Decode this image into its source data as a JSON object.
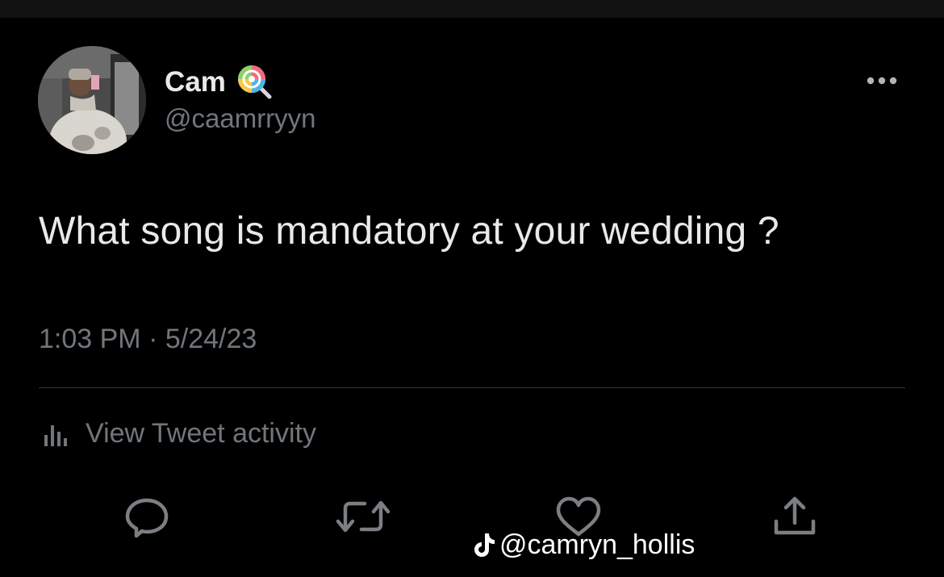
{
  "user": {
    "display_name": "Cam",
    "handle": "@caamrryyn",
    "name_emoji": "lollipop-icon"
  },
  "tweet": {
    "text": "What song is mandatory at your wedding ?",
    "time": "1:03 PM",
    "separator": "·",
    "date": "5/24/23"
  },
  "activity": {
    "label": "View Tweet activity",
    "icon": "bar-chart-icon"
  },
  "actions": [
    "reply-icon",
    "retweet-icon",
    "like-icon",
    "share-icon"
  ],
  "watermark": {
    "icon": "tiktok-icon",
    "text": "@camryn_hollis"
  },
  "colors": {
    "background": "#000000",
    "text_primary": "#e7e9ea",
    "text_secondary": "#71767b",
    "divider": "#2f3336"
  }
}
